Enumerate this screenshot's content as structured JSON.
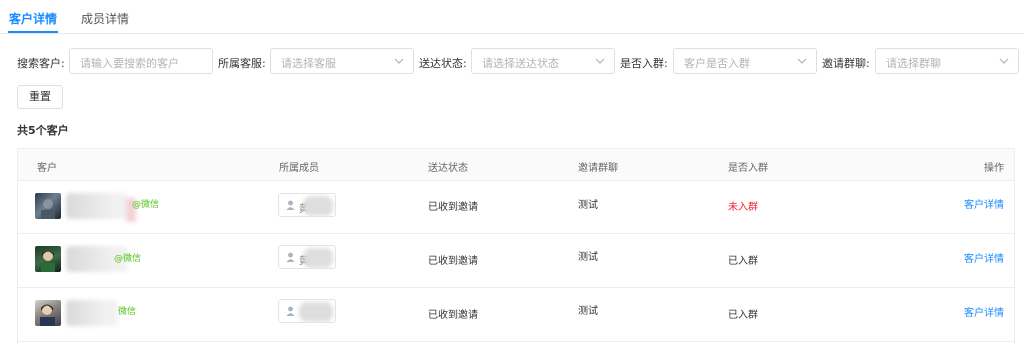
{
  "tabs": [
    {
      "label": "客户详情",
      "active": true
    },
    {
      "label": "成员详情",
      "active": false
    }
  ],
  "filters": {
    "search_label": "搜索客户:",
    "search_placeholder": "请输入要搜索的客户",
    "staff_label": "所属客服:",
    "staff_placeholder": "请选择客服",
    "send_status_label": "送达状态:",
    "send_status_placeholder": "请选择送达状态",
    "joined_label": "是否入群:",
    "joined_placeholder": "客户是否入群",
    "group_label": "邀请群聊:",
    "group_placeholder": "请选择群聊"
  },
  "reset_label": "重置",
  "total_text": "共5个客户",
  "table": {
    "headers": [
      "客户",
      "所属成员",
      "送达状态",
      "邀请群聊",
      "是否入群",
      "操作"
    ],
    "rows": [
      {
        "wechat_tag": "@微信",
        "member_initial": "黄",
        "send_status": "已收到邀请",
        "group": "测试",
        "joined": "未入群",
        "action": "客户详情"
      },
      {
        "wechat_tag": "@微信",
        "member_initial": "黄",
        "send_status": "已收到邀请",
        "group": "测试",
        "joined": "已入群",
        "action": "客户详情"
      },
      {
        "wechat_tag": "微信",
        "member_initial": "",
        "send_status": "已收到邀请",
        "group": "测试",
        "joined": "已入群",
        "action": "客户详情"
      }
    ]
  },
  "colors": {
    "accent": "#1a8cff",
    "wechat_green": "#52c41a",
    "status_red": "#f5222d"
  }
}
